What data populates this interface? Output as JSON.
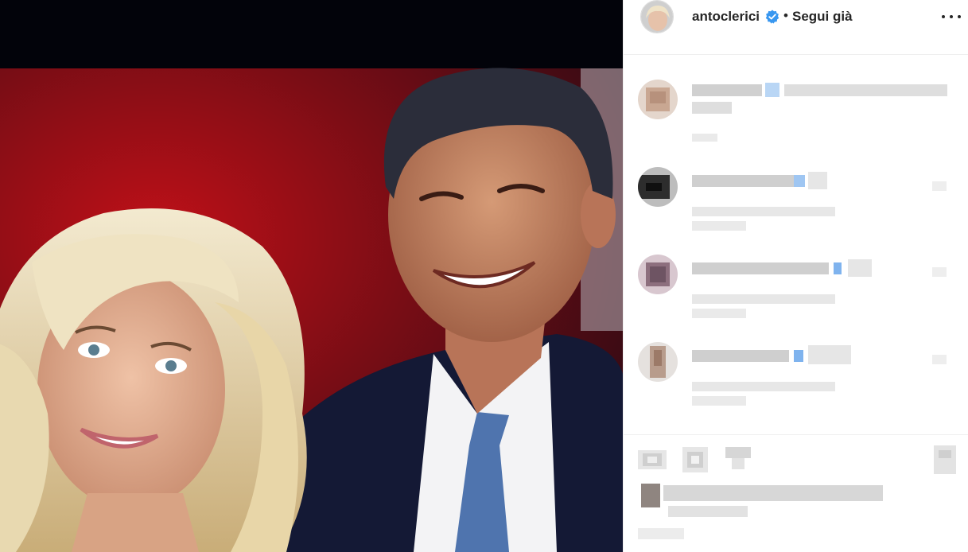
{
  "post": {
    "username": "antoclerici",
    "verified": true,
    "separator": "•",
    "follow_status": "Segui già"
  },
  "icons": {
    "verified": "verified-badge-icon",
    "more": "more-options-icon",
    "like": "heart-icon",
    "comment": "comment-icon",
    "share": "share-icon",
    "save": "bookmark-icon"
  },
  "colors": {
    "accent_blue": "#3897f0",
    "text": "#262626",
    "divider": "#efefef"
  }
}
